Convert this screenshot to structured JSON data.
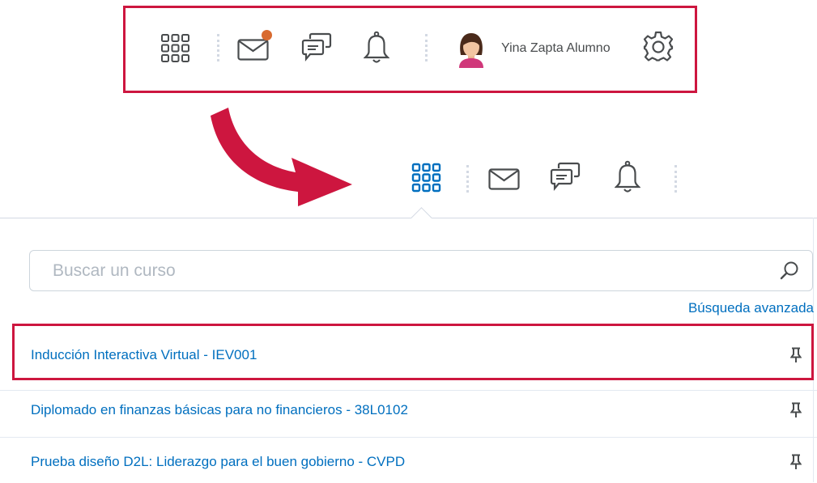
{
  "colors": {
    "accent_red": "#cd163f",
    "link_blue": "#006fbf",
    "icon_grey": "#494c4e",
    "notif_orange": "#d86a2f",
    "active_blue": "#006fbf"
  },
  "top_nav": {
    "icons": [
      "grid-icon",
      "envelope-icon",
      "chat-icon",
      "bell-icon",
      "gear-icon"
    ],
    "user_name": "Yina Zapta Alumno"
  },
  "bottom_nav": {
    "icons": [
      "grid-icon",
      "envelope-icon",
      "chat-icon",
      "bell-icon"
    ]
  },
  "course_selector": {
    "search_placeholder": "Buscar un curso",
    "advanced_search": "Búsqueda avanzada",
    "courses": [
      {
        "name": "Inducción Interactiva Virtual - IEV001",
        "pinned": true
      },
      {
        "name": "Diplomado en finanzas básicas para no financieros - 38L0102",
        "pinned": true
      },
      {
        "name": "Prueba diseño D2L: Liderazgo para el buen gobierno - CVPD",
        "pinned": true
      }
    ]
  }
}
